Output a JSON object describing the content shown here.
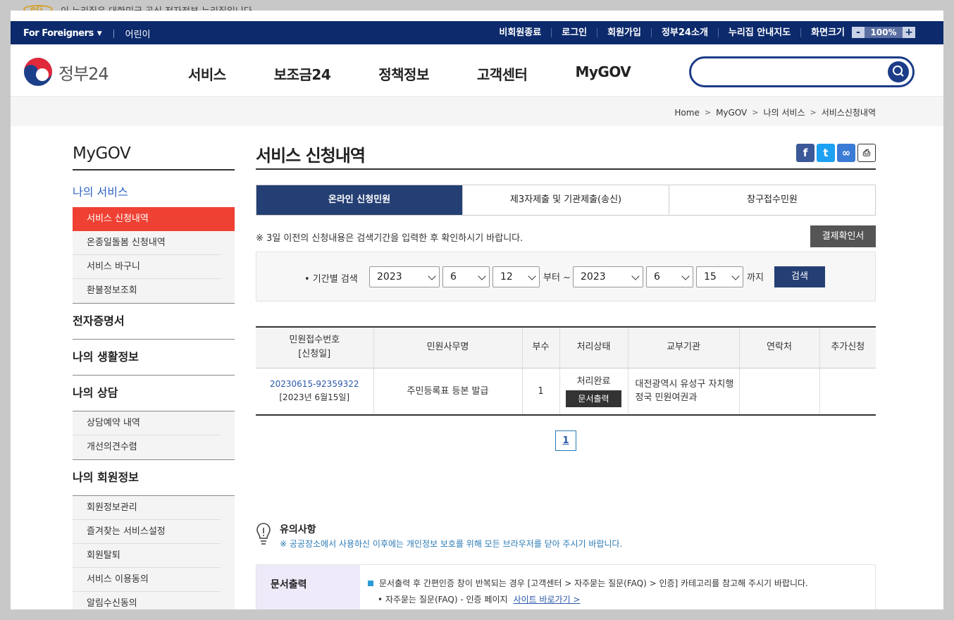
{
  "official_banner": {
    "text": "이 누리집은 대한민국 공식 전자정부 누리집입니다."
  },
  "util": {
    "foreigners": "For Foreigners",
    "kids": "어린이",
    "links": [
      "비회원종료",
      "로그인",
      "회원가입",
      "정부24소개",
      "누리집 안내지도"
    ],
    "zoom_label": "화면크기",
    "zoom_minus": "-",
    "zoom_value": "100%",
    "zoom_plus": "+"
  },
  "header": {
    "brand": "정부24",
    "nav": [
      "서비스",
      "보조금24",
      "정책정보",
      "고객센터",
      "MyGOV"
    ],
    "search_placeholder": ""
  },
  "breadcrumb": [
    "Home",
    "MyGOV",
    "나의 서비스",
    "서비스신청내역"
  ],
  "sidebar": {
    "title": "MyGOV",
    "active_section": "나의 서비스",
    "service_items": [
      "서비스 신청내역",
      "온종일돌봄 신청내역",
      "서비스 바구니",
      "환불정보조회"
    ],
    "sections": [
      "전자증명서",
      "나의 생활정보",
      "나의 상담"
    ],
    "consult_items": [
      "상담예약 내역",
      "개선의견수렴"
    ],
    "member_section": "나의 회원정보",
    "member_items": [
      "회원정보관리",
      "즐겨찾는 서비스설정",
      "회원탈퇴",
      "서비스 이용동의",
      "알림수신동의"
    ]
  },
  "main": {
    "title": "서비스 신청내역",
    "tabs": [
      "온라인 신청민원",
      "제3자제출 및 기관제출(송신)",
      "창구접수민원"
    ],
    "note": "※ 3일 이전의 신청내용은 검색기간을 입력한 후 확인하시기 바랍니다.",
    "pay_button": "결제확인서",
    "filter": {
      "label": "• 기간별 검색",
      "from_year": "2023",
      "from_month": "6",
      "from_day": "12",
      "from_word": "부터 ~",
      "to_year": "2023",
      "to_month": "6",
      "to_day": "15",
      "to_word": "까지",
      "search_button": "검색"
    },
    "table": {
      "headers": [
        "민원접수번호",
        "[신청일]",
        "민원사무명",
        "부수",
        "처리상태",
        "교부기관",
        "연락처",
        "추가신청"
      ],
      "row": {
        "receipt_no": "20230615-92359322",
        "date": "[2023년 6월15일]",
        "name": "주민등록표 등본 발급",
        "copies": "1",
        "status": "처리완료",
        "print_button": "문서출력",
        "org": "대전광역시 유성구 자치행정국 민원여권과",
        "contact": "",
        "extra": ""
      }
    },
    "pagination": "1",
    "caution": {
      "title": "유의사항",
      "text": "※ 공공장소에서 사용하신 이후에는 개인정보 보호를 위해 모든 브라우저를 닫아 주시기 바랍니다."
    },
    "infobox": {
      "label": "문서출력",
      "line1": "문서출력 후 간편인증 창이 반복되는 경우 [고객센터 > 자주묻는 질문(FAQ) > 인증] 카테고리를 참고해 주시기 바랍니다.",
      "line2": "• 자주묻는 질문(FAQ) - 인증 페이지",
      "link": "사이트 바로가기 >"
    }
  }
}
